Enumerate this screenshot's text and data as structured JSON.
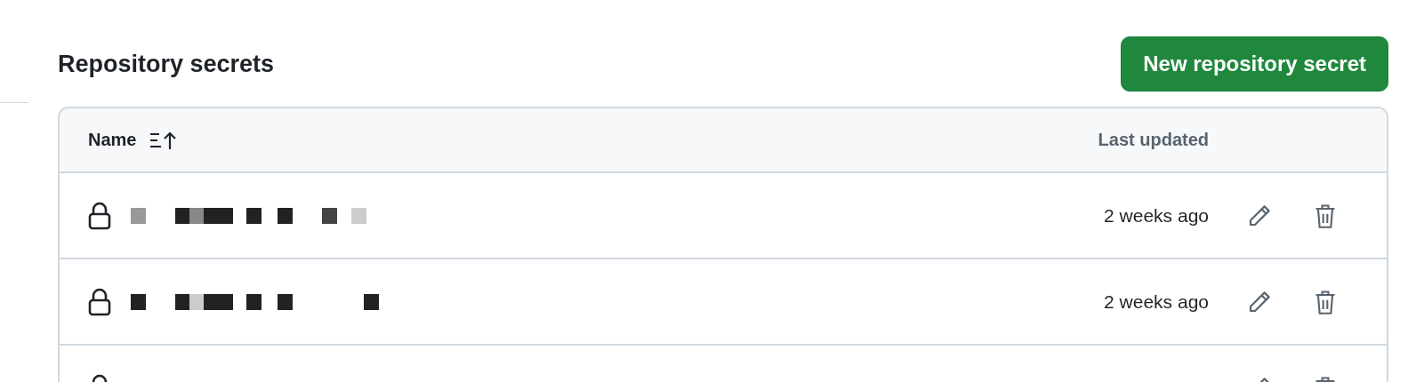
{
  "section": {
    "title": "Repository secrets",
    "button": "New repository secret"
  },
  "table": {
    "columns": [
      {
        "label": "Name",
        "sortable": true
      },
      {
        "label": "Last updated",
        "sortable": false
      }
    ],
    "rows": [
      {
        "updated": "2 weeks ago"
      },
      {
        "updated": "2 weeks ago"
      },
      {}
    ]
  }
}
